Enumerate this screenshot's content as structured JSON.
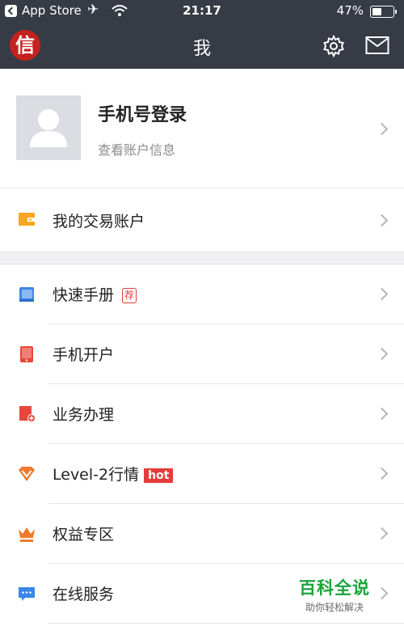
{
  "status_bar": {
    "back_app": "App Store",
    "time": "21:17",
    "battery": "47%",
    "battery_level": 0.47
  },
  "header": {
    "logo_text": "信",
    "title": "我"
  },
  "profile": {
    "name": "手机号登录",
    "subtitle": "查看账户信息"
  },
  "trade_account": {
    "label": "我的交易账户"
  },
  "menu": [
    {
      "label": "快速手册",
      "tag": "荐",
      "icon": "book-icon"
    },
    {
      "label": "手机开户",
      "icon": "tablet-icon"
    },
    {
      "label": "业务办理",
      "icon": "business-doc-icon"
    },
    {
      "label": "Level-2行情",
      "tag": "hot",
      "icon": "diamond-icon"
    },
    {
      "label": "权益专区",
      "icon": "crown-icon"
    },
    {
      "label": "在线服务",
      "icon": "chat-icon"
    }
  ],
  "watermark": {
    "title": "百科全说",
    "subtitle": "助你轻松解决"
  },
  "colors": {
    "header_bg": "#373b45",
    "accent_red": "#e03a3a",
    "wallet_orange": "#f5a623",
    "diamond_orange": "#f07a2b",
    "chat_blue": "#3b86e8",
    "watermark_green": "#19a53a"
  }
}
